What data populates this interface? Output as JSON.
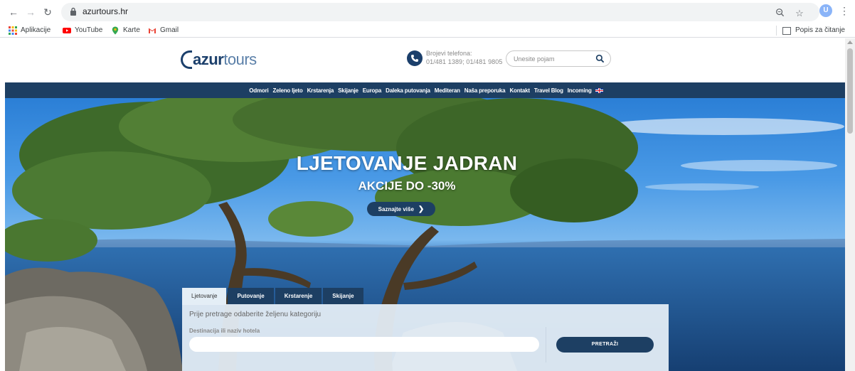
{
  "browser": {
    "url": "azurtours.hr",
    "bookmarks": [
      "Aplikacije",
      "YouTube",
      "Karte",
      "Gmail"
    ],
    "reading_list": "Popis za čitanje",
    "profile_initial": "U"
  },
  "header": {
    "logo_bold": "azur",
    "logo_light": "tours",
    "phone_label": "Brojevi telefona:",
    "phone_numbers": "01/481 1389; 01/481 9805",
    "search_placeholder": "Unesite pojam"
  },
  "menu": [
    "Odmori",
    "Zeleno ljeto",
    "Krstarenja",
    "Skijanje",
    "Europa",
    "Daleka putovanja",
    "Mediteran",
    "Naša preporuka",
    "Kontakt",
    "Travel Blog",
    "Incoming"
  ],
  "hero": {
    "title": "LJETOVANJE JADRAN",
    "subtitle": "AKCIJE DO -30%",
    "button": "Saznajte više"
  },
  "search_widget": {
    "tabs": [
      "Ljetovanje",
      "Putovanje",
      "Krstarenje",
      "Skijanje"
    ],
    "active_tab": "Ljetovanje",
    "hint": "Prije pretrage odaberite željenu kategoriju",
    "destination_label": "Destinacija ili naziv hotela",
    "destination_value": "",
    "submit": "PRETRAŽI"
  },
  "colors": {
    "brand_navy": "#1d3f63",
    "logo_blue": "#5a7fa8",
    "panel_bg": "#e4eef6"
  }
}
